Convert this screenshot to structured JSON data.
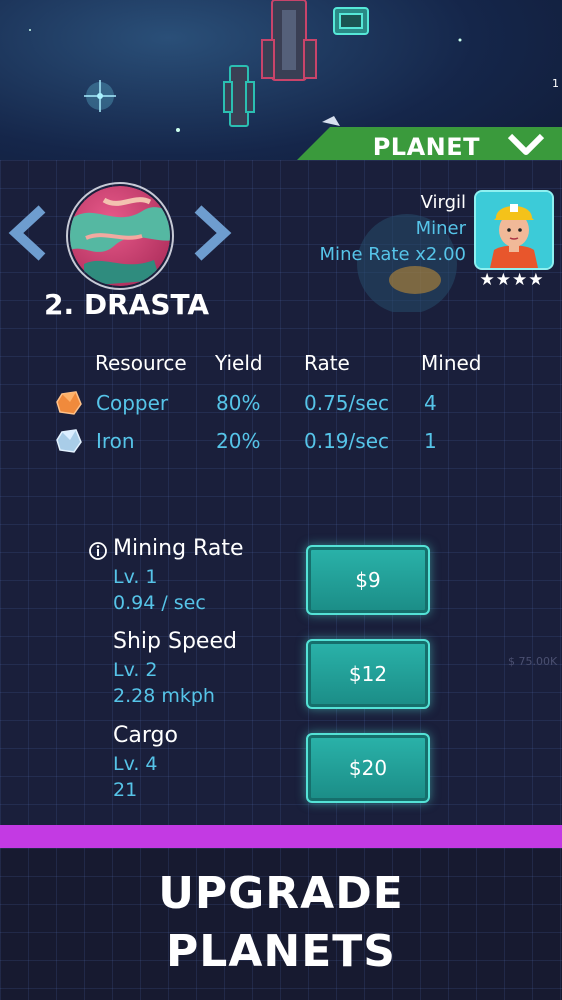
{
  "header": {
    "tab_label": "PLANET",
    "corner_number": "1"
  },
  "planet": {
    "name": "2. DRASTA"
  },
  "miner": {
    "name": "Virgil",
    "role": "Miner",
    "rate": "Mine Rate x2.00",
    "stars": "★★★★",
    "rating": 4
  },
  "resources": {
    "headers": [
      "Resource",
      "Yield",
      "Rate",
      "Mined"
    ],
    "rows": [
      {
        "name": "Copper",
        "yield": "80%",
        "rate": "0.75/sec",
        "mined": "4",
        "icon": "copper-ore-icon",
        "color": "#f08a3c"
      },
      {
        "name": "Iron",
        "yield": "20%",
        "rate": "0.19/sec",
        "mined": "1",
        "icon": "iron-ore-icon",
        "color": "#a9cde8"
      }
    ]
  },
  "upgrades": [
    {
      "title": "Mining Rate",
      "level": "Lv. 1",
      "value": "0.94 / sec",
      "price": "$9"
    },
    {
      "title": "Ship Speed",
      "level": "Lv. 2",
      "value": "2.28 mkph",
      "price": "$12"
    },
    {
      "title": "Cargo",
      "level": "Lv. 4",
      "value": "21",
      "price": "$20"
    }
  ],
  "background_price": "$ 75.00K",
  "promo": {
    "line1": "UPGRADE",
    "line2": "PLANETS"
  },
  "colors": {
    "accent_cyan": "#56c4e8",
    "button_teal": "#2ab3aa",
    "tab_green": "#3a9a3c",
    "promo_purple": "#c33ae3"
  }
}
